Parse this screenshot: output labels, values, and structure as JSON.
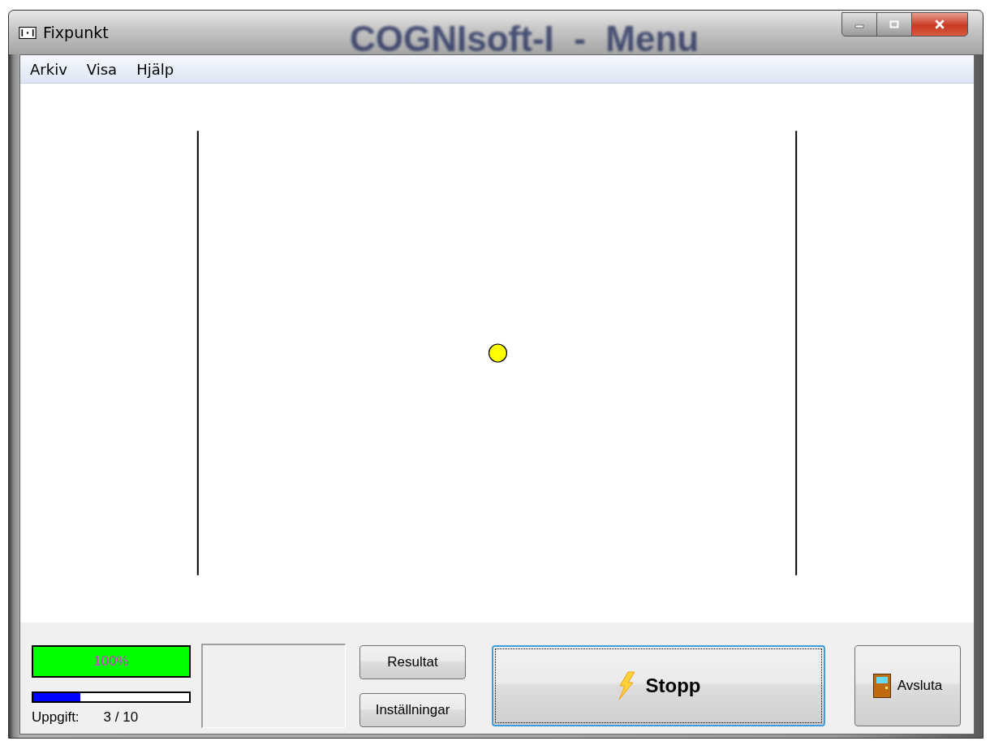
{
  "window": {
    "title": "Fixpunkt",
    "background_title": "COGNIsoft-I  -  Menu"
  },
  "menu": [
    {
      "label": "Arkiv"
    },
    {
      "label": "Visa"
    },
    {
      "label": "Hjälp"
    }
  ],
  "progress": {
    "label": "100%",
    "level": 1
  },
  "task": {
    "level": 0.3,
    "label": "Uppgift:",
    "value": "3 / 10"
  },
  "buttons": [
    {
      "kind": "small",
      "label": "Resultat"
    },
    {
      "kind": "small",
      "label": "Inställningar"
    },
    {
      "kind": "start",
      "label": "Stopp",
      "focused": true
    },
    {
      "kind": "exit",
      "label": "Avsluta",
      "focused": false
    }
  ]
}
